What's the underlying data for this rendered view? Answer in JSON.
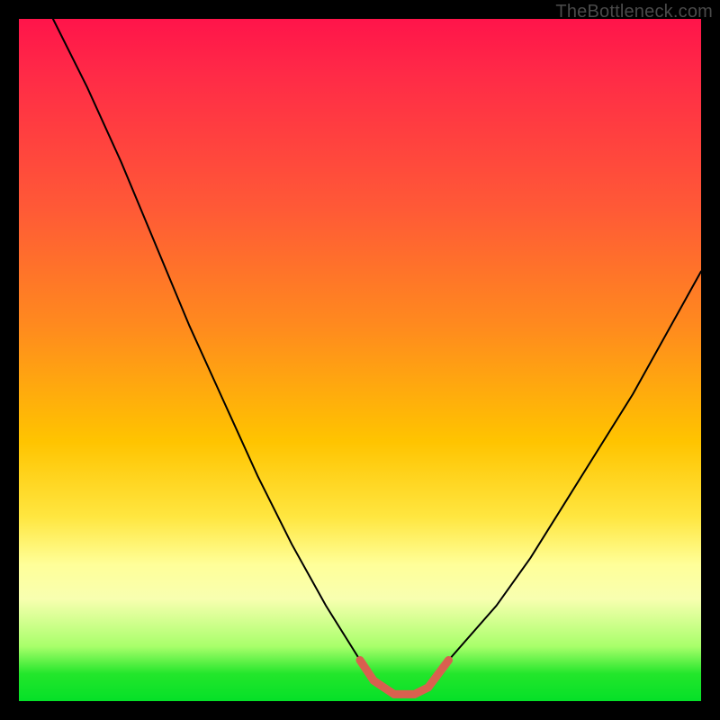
{
  "watermark": "TheBottleneck.com",
  "chart_data": {
    "type": "line",
    "title": "",
    "xlabel": "",
    "ylabel": "",
    "xlim": [
      0,
      100
    ],
    "ylim": [
      0,
      100
    ],
    "grid": false,
    "legend": false,
    "series": [
      {
        "name": "curve",
        "color": "#000000",
        "x": [
          5,
          10,
          15,
          20,
          25,
          30,
          35,
          40,
          45,
          50,
          52,
          55,
          58,
          60,
          63,
          70,
          75,
          80,
          85,
          90,
          95,
          100
        ],
        "y": [
          100,
          90,
          79,
          67,
          55,
          44,
          33,
          23,
          14,
          6,
          3,
          1,
          1,
          2,
          6,
          14,
          21,
          29,
          37,
          45,
          54,
          63
        ]
      },
      {
        "name": "highlight-segment",
        "color": "#d9604f",
        "x": [
          50,
          52,
          55,
          58,
          60,
          63
        ],
        "y": [
          6,
          3,
          1,
          1,
          2,
          6
        ]
      }
    ],
    "background_gradient_stops": [
      {
        "pos": 0,
        "color": "#ff144a"
      },
      {
        "pos": 28,
        "color": "#ff5a36"
      },
      {
        "pos": 62,
        "color": "#ffc400"
      },
      {
        "pos": 85,
        "color": "#f8ffb0"
      },
      {
        "pos": 100,
        "color": "#05e028"
      }
    ]
  }
}
